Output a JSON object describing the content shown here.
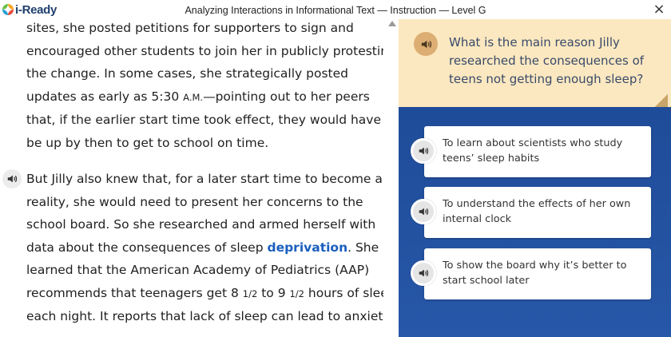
{
  "app": {
    "logo_text": "i-Ready",
    "window_title": "Analyzing Interactions in Informational Text — Instruction — Level G",
    "close_label": "×",
    "logo_colors": [
      "#6cc04a",
      "#f6a623",
      "#e84c3d",
      "#2a9fd8"
    ]
  },
  "passage": {
    "paragraph1": {
      "lines": [
        "sites, she posted petitions for supporters to sign and",
        "encouraged other students to join her in publicly protesting",
        "the change. In some cases, she strategically posted"
      ],
      "line4_a": "updates as early as 5:30 ",
      "line4_am": "A.M.",
      "line4_b": "—pointing out to her peers",
      "line5": "that, if the earlier start time took effect, they would have to",
      "line6": "be up by then to get to school on time."
    },
    "paragraph2": {
      "line1": "But Jilly also knew that, for a later start time to become a",
      "line2": "reality, she would need to present her concerns to the",
      "line3": "school board. So she researched and armed herself with",
      "line4_a": "data about the consequences of sleep ",
      "line4_vocab": "deprivation",
      "line4_b": ". She",
      "line5": "learned that the American Academy of Pediatrics (AAP)",
      "line6_a": "recommends that teenagers get 8 ",
      "line6_frac1": "1/2",
      "line6_b": " to 9 ",
      "line6_frac2": "1/2",
      "line6_c": " hours of sleep",
      "line7": "each night. It reports that lack of sleep can lead to anxiety,"
    },
    "vocab_color": "#1a5fbf"
  },
  "question": {
    "text": "What is the main reason Jilly researched the consequences of teens not getting enough sleep?"
  },
  "options": [
    {
      "text": "To learn about scientists who study teens’ sleep habits"
    },
    {
      "text": "To understand the effects of her own internal clock"
    },
    {
      "text": "To show the board why it’s better to start school later"
    }
  ],
  "colors": {
    "panel_blue": "#214e9a",
    "question_bg": "#fbe8c0",
    "question_speaker": "#dcae73"
  },
  "icons": {
    "speaker": "speaker-icon",
    "scroll_up": "scroll-up-arrow-icon",
    "close": "close-icon"
  }
}
